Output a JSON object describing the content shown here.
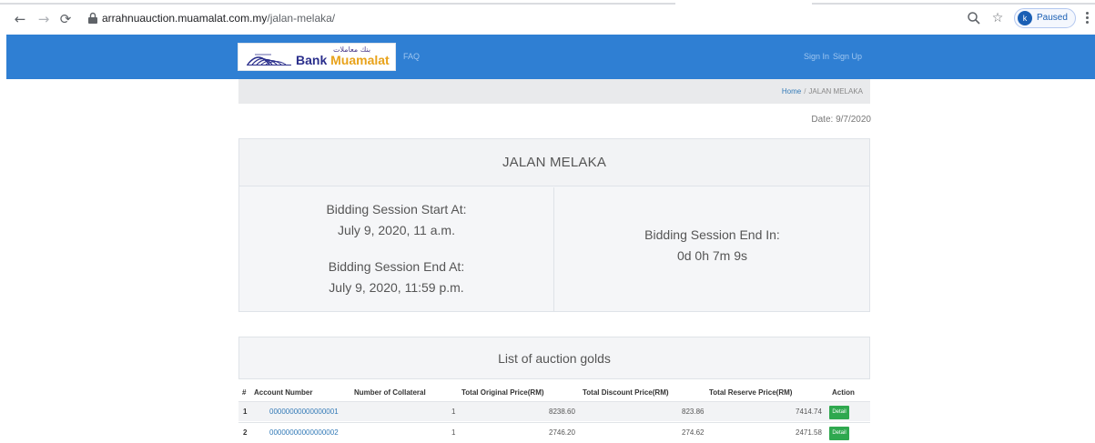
{
  "browser": {
    "url_domain": "arrahnuauction.muamalat.com.my",
    "url_path": "/jalan-melaka/",
    "profile_initial": "k",
    "profile_label": "Paused"
  },
  "nav": {
    "logo_text_bank": "Bank",
    "logo_text_name": "Muamalat",
    "logo_arabic": "بنك معاملات",
    "faq_label": "FAQ",
    "sign_in_label": "Sign In",
    "sign_up_label": "Sign Up"
  },
  "breadcrumb": {
    "home_label": "Home",
    "separator": "/",
    "current_label": "JALAN MELAKA"
  },
  "date_label": "Date: 9/7/2020",
  "session": {
    "title": "JALAN MELAKA",
    "start_label": "Bidding Session Start At:",
    "start_value": "July 9, 2020, 11 a.m.",
    "end_label": "Bidding Session End At:",
    "end_value": "July 9, 2020, 11:59 p.m.",
    "countdown_label": "Bidding Session End In:",
    "countdown_value": "0d 0h 7m 9s"
  },
  "auction_list": {
    "title": "List of auction golds",
    "columns": [
      "#",
      "Account Number",
      "Number of Collateral",
      "Total Original Price(RM)",
      "Total Discount Price(RM)",
      "Total Reserve Price(RM)",
      "Action"
    ],
    "rows": [
      {
        "index": "1",
        "account_number": "00000000000000001",
        "collateral": "1",
        "original_price": "8238.60",
        "discount_price": "823.86",
        "reserve_price": "7414.74",
        "action_label": "Detail"
      },
      {
        "index": "2",
        "account_number": "00000000000000002",
        "collateral": "1",
        "original_price": "2746.20",
        "discount_price": "274.62",
        "reserve_price": "2471.58",
        "action_label": "Detail"
      }
    ]
  },
  "colors": {
    "nav_blue": "#2f7fd3",
    "link_blue": "#337ab7",
    "detail_green": "#2fa84f"
  }
}
